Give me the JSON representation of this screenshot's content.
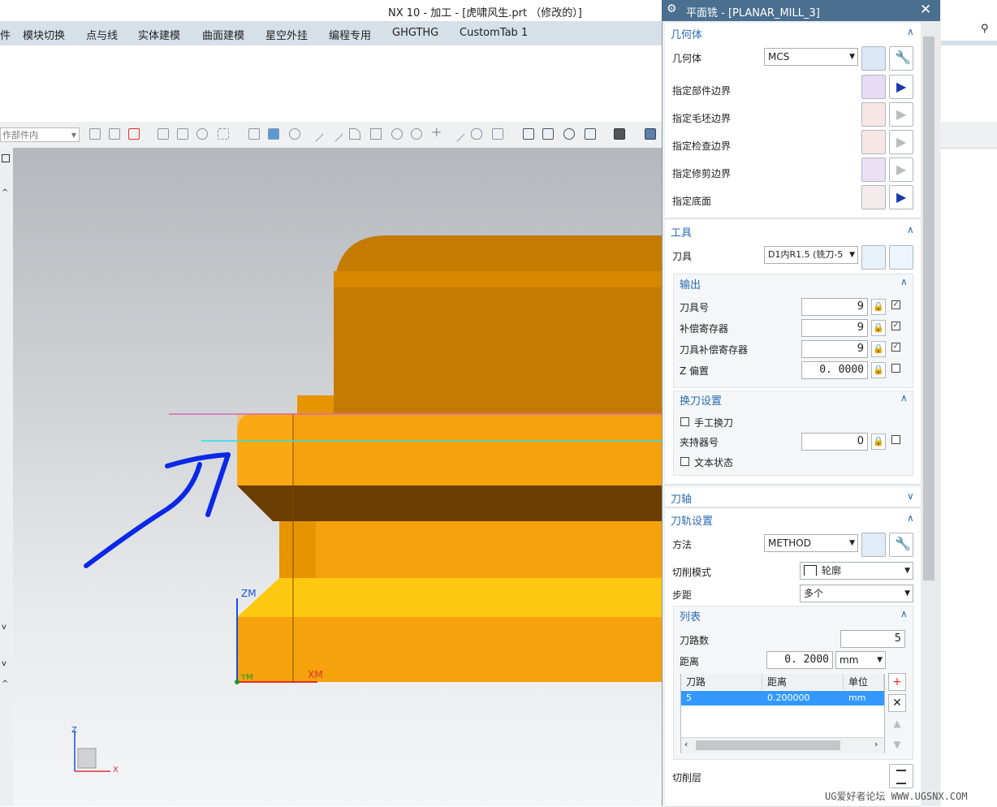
{
  "window": {
    "title": "NX 10 - 加工 - [虎啸风生.prt （修改的）]"
  },
  "ribbon": {
    "tabs": [
      "模块切换",
      "点与线",
      "实体建模",
      "曲面建模",
      "星空外挂",
      "编程专用",
      "GHGTHG",
      "CustomTab 1"
    ],
    "first_partial": "件"
  },
  "toolbar": {
    "filter_value": "作部件内"
  },
  "viewport": {
    "csys_labels": {
      "zm": "ZM",
      "xm": "XM",
      "ym": "YM",
      "z": "Z",
      "x": "X"
    }
  },
  "dialog": {
    "title": "平面铣 - [PLANAR_MILL_3]",
    "geometry": {
      "header": "几何体",
      "geometry_label": "几何体",
      "geometry_value": "MCS",
      "rows": [
        "指定部件边界",
        "指定毛坯边界",
        "指定检查边界",
        "指定修剪边界",
        "指定底面"
      ]
    },
    "tool": {
      "header": "工具",
      "tool_label": "刀具",
      "tool_value": "D1内R1.5 (铣刀-5",
      "output": {
        "header": "输出",
        "rows": [
          {
            "label": "刀具号",
            "value": "9",
            "checked": true
          },
          {
            "label": "补偿寄存器",
            "value": "9",
            "checked": true
          },
          {
            "label": "刀具补偿寄存器",
            "value": "9",
            "checked": true
          },
          {
            "label": "Z 偏置",
            "value": "0. 0000",
            "checked": false
          }
        ]
      },
      "toolchange": {
        "header": "换刀设置",
        "manual_label": "手工换刀",
        "holder_label": "夹持器号",
        "holder_value": "0",
        "text_state_label": "文本状态"
      }
    },
    "axis": {
      "header": "刀轴"
    },
    "path": {
      "header": "刀轨设置",
      "method_label": "方法",
      "method_value": "METHOD",
      "cut_mode_label": "切削模式",
      "cut_mode_value": "轮廓",
      "stepover_label": "步距",
      "stepover_value": "多个",
      "list": {
        "header": "列表",
        "passes_label": "刀路数",
        "passes_value": "5",
        "distance_label": "距离",
        "distance_value": "0. 2000",
        "distance_unit": "mm",
        "columns": [
          "刀路",
          "距离",
          "单位"
        ],
        "rows": [
          [
            "5",
            "0.200000",
            "mm"
          ]
        ]
      },
      "cut_levels_label": "切削层"
    }
  },
  "watermark": "UG爱好者论坛 WWW.UGSNX.COM",
  "colors": {
    "orange": "#f5a20c",
    "dark_orange": "#c57a00",
    "brown": "#6b3d00",
    "yellow": "#ffc810",
    "annotation_blue": "#0a28e6",
    "accent": "#2a6cb3"
  }
}
